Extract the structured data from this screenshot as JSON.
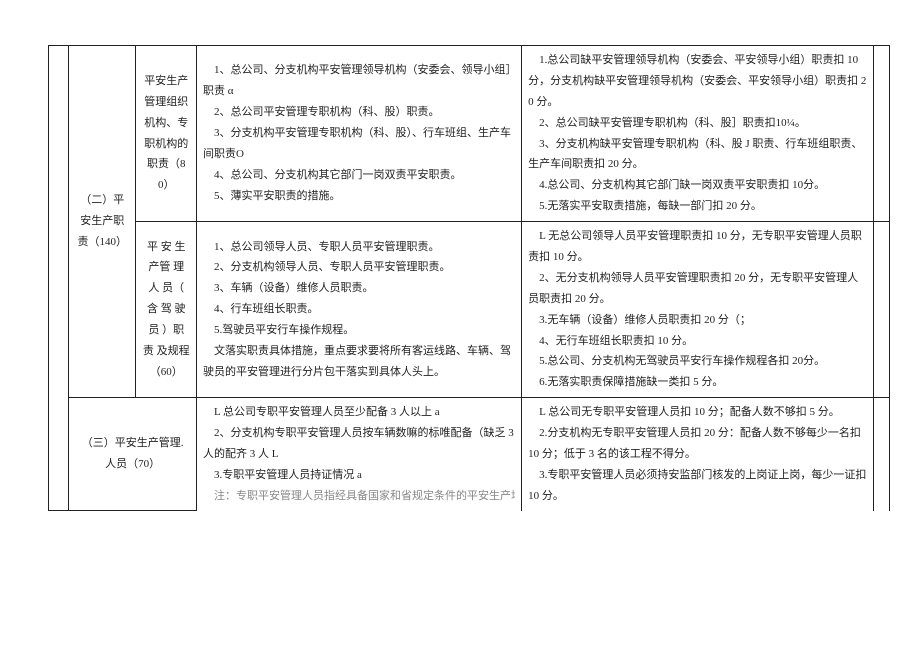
{
  "rows": {
    "r1": {
      "col0": "",
      "col1": "（二）平安生产职责（140）",
      "col2": "平安生产管理组织机构、专职机构的职责（80）",
      "col3_lines": [
        "1、总公司、分支机构平安管理领导机构（安委会、领导小组］职责 α",
        "2、总公司平安管理专职机构（科、股）职责。",
        "3、分支机构平安管理专职机构（科、股）、行车班组、生产车间职责O",
        "4、总公司、分支机构其它部门一岗双责平安职责。",
        "5、薄实平安职责的措施。"
      ],
      "col4_lines": [
        "1.总公司缺平安管理领导机构（安委会、平安领导小组）职责扣 10 分，分支机构缺平安管理领导机构（安委会、平安领导小组）职责扣 20 分。",
        "2、总公司缺平安管理专职机构（科、股］职责扣10¼。",
        "3、分支机构缺平安管理专职机构（科、股 J 职责、行车班组职责、生产车间职责扣 20 分。",
        "4.总公司、分支机构其它部门缺一岗双责平安职责扣 10分。",
        "5.无落实平安取责措施，每缺一部门扣 20 分。"
      ],
      "col5": ""
    },
    "r2": {
      "col2": "平 安 生 产管 理 人 员（ 含 驾 驶员 ）职 责 及规程（60）",
      "col3_lines": [
        "1、总公司领导人员、专职人员平安管理职责。",
        "2、分支机构领导人员、专职人员平安管理职责。",
        "3、车辆（设备）维修人员职责。",
        "4、行车班组长职责。",
        "5.驾驶员平安行车操作规程。",
        "文落实职责具体措施，重点要求要将所有客运线路、车辆、驾驶员的平安管理进行分片包干落实到具体人头上。"
      ],
      "col4_lines": [
        "L 无总公司领导人员平安管理职责扣 10 分，无专职平安管理人员职责扣 10 分。",
        "2、无分支机构领导人员平安管理职责扣 20 分，无专职平安管理人员职责扣 20 分。",
        "3.无车辆（设备）维修人员职责扣 20 分（；",
        "4、无行车班组长职责扣 10 分。",
        "5.总公司、分支机构无驾驶员平安行车操作规程各扣 20分。",
        "6.无落实职责保障措施缺一类扣 5 分。"
      ],
      "col5": ""
    },
    "r3": {
      "col1": "（三）平安生产管理. 人员（70）",
      "col3_lines": [
        "L 总公司专职平安管理人员至少配备 3 人以上 a",
        "2、分支机构专职平安管理人员按车辆数嘛的标唯配备（缺乏 3 人的配齐 3 人 L",
        "3.专职平安管理人员持证情况 a",
        "注：专职平安管理人员指经具备国家和省规定条件的平安生产培训机构培训合格持证上岗的，专门从事平安管理的人员"
      ],
      "col4_lines": [
        "L 总公司无专职平安管理人员扣 10 分；配备人数不够扣 5 分。",
        "2.分支机构无专职平安管理人员扣 20 分：配备人数不够每少一名扣 10 分；低于 3 名的该工程不得分。",
        "3.专职平安管理人员必须持安监部门核发的上岗证上岗，每少一证扣 10 分。"
      ],
      "col5": ""
    }
  }
}
